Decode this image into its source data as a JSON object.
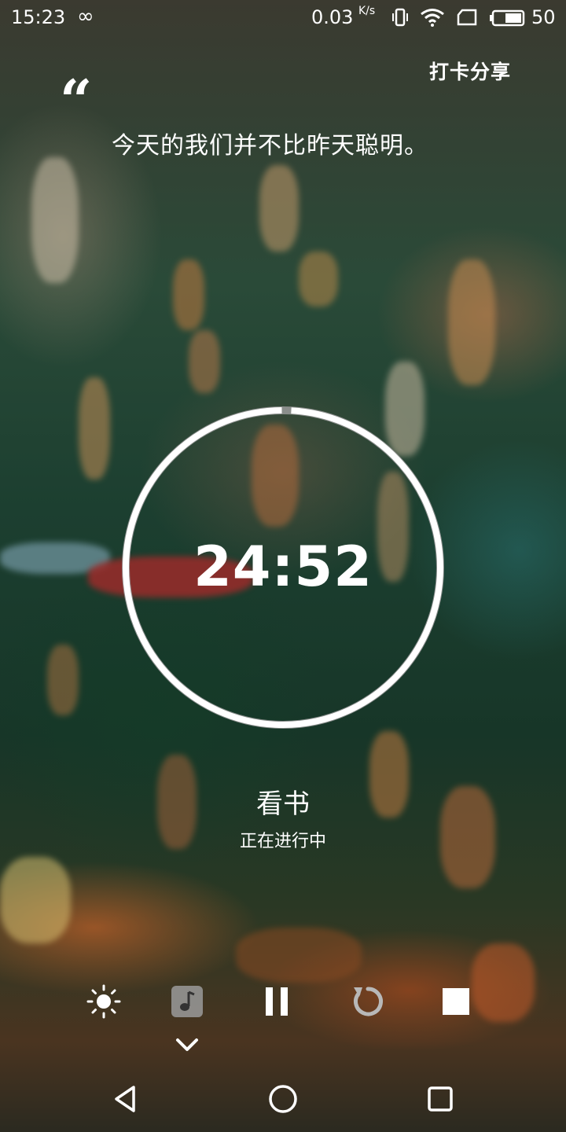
{
  "status_bar": {
    "time": "15:23",
    "net_speed": "0.03",
    "net_unit": "K/s",
    "battery": "50",
    "icons": [
      "infinity-icon",
      "vibrate-icon",
      "wifi-icon",
      "sim-icon",
      "battery-icon"
    ]
  },
  "header": {
    "share_label": "打卡分享"
  },
  "quote": {
    "mark": "“",
    "text": "今天的我们并不比昨天聪明。"
  },
  "timer": {
    "display": "24:52",
    "remaining_fraction": 0.99
  },
  "task": {
    "name": "看书",
    "status": "正在进行中"
  },
  "controls": {
    "icons": [
      "brightness-icon",
      "music-note-icon",
      "pause-icon",
      "restart-icon",
      "stop-icon",
      "chevron-down-icon"
    ]
  },
  "nav_bar": {
    "icons": [
      "back-triangle-icon",
      "home-circle-icon",
      "recents-square-icon"
    ]
  },
  "colors": {
    "ring": "#ffffff",
    "ring_track": "#9a9a9a",
    "text": "#ffffff"
  }
}
